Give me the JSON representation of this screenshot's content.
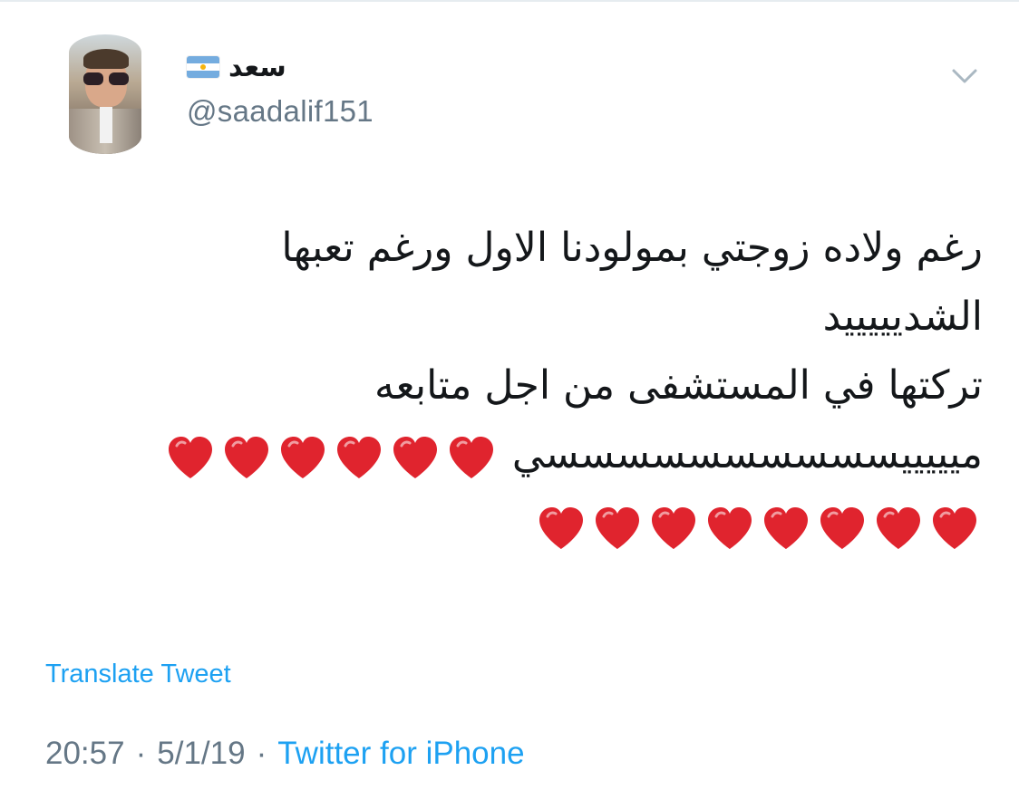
{
  "user": {
    "display_name": "سعد",
    "handle": "@saadalif151",
    "flag_icon": "argentina-flag-icon",
    "avatar_icon": "user-avatar-photo"
  },
  "header": {
    "menu_icon": "chevron-down-icon",
    "chevron_color": "#aab8c2"
  },
  "tweet": {
    "lines": [
      "رغم ولاده زوجتي بمولودنا الاول ورغم تعبها",
      "الشديييييد",
      "تركتها في المستشفى من اجل متابعه",
      "ميييييسسسسسسسسسسي"
    ],
    "heart_icon": "red-heart-emoji",
    "heart_color": "#e0242e",
    "hearts_line4_count": 6,
    "hearts_line5_count": 8
  },
  "translate_label": "Translate Tweet",
  "meta": {
    "time": "20:57",
    "separator": "·",
    "date": "5/1/19",
    "source": "Twitter for iPhone"
  },
  "colors": {
    "link": "#1da1f2",
    "secondary_text": "#657786",
    "primary_text": "#14171a",
    "border": "#e6ecf0"
  }
}
